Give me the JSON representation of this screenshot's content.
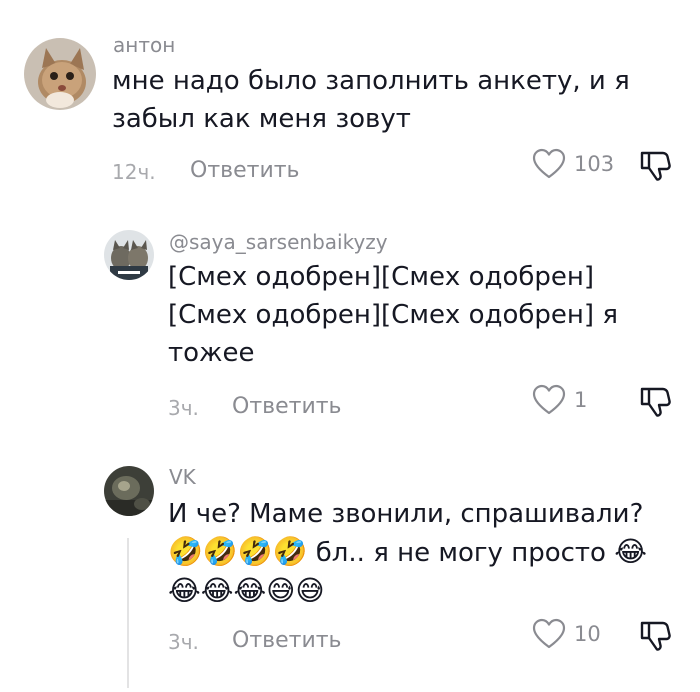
{
  "comments": [
    {
      "username": "антон",
      "text_lines": [
        "мне надо было заполнить анкету, и я",
        "забыл как меня зовут"
      ],
      "time": "12ч.",
      "reply_label": "Ответить",
      "likes": "103",
      "avatar_icon": "cat-avatar-icon"
    },
    {
      "username": "@saya_sarsenbaikyzy",
      "text_lines": [
        "[Смех одобрен][Смех одобрен]",
        "[Смех одобрен][Смех одобрен] я",
        "тожее"
      ],
      "time": "3ч.",
      "reply_label": "Ответить",
      "likes": "1",
      "avatar_icon": "cats-avatar-icon"
    },
    {
      "username": "VK",
      "text_line1": "И че? Маме звонили, спрашивали?",
      "emoji_rofl": "🤣",
      "text_line2_mid": " бл.. я не могу просто ",
      "emoji_joy": "😂",
      "emoji_sweat": "😅",
      "time": "3ч.",
      "reply_label": "Ответить",
      "likes": "10",
      "avatar_icon": "dark-photo-avatar-icon"
    }
  ],
  "colors": {
    "text": "#161823",
    "muted": "#8a8b91",
    "icon": "#8a8b91"
  }
}
